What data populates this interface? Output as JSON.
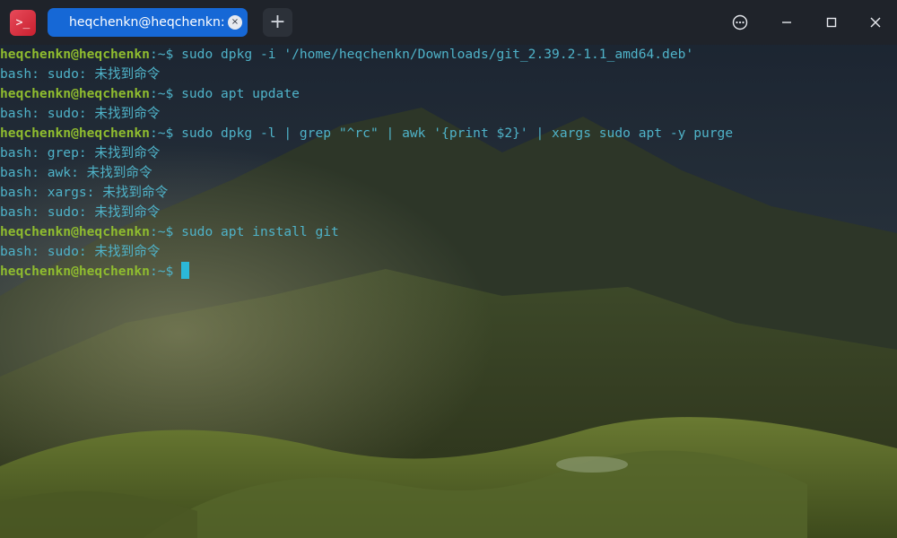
{
  "window": {
    "tab_title": "heqchenkn@heqchenkn: ~",
    "tab_close_glyph": "×",
    "new_tab_glyph": "+",
    "app_icon_glyph": ">_"
  },
  "colors": {
    "titlebar": "#1f232a",
    "active_tab": "#1668d6",
    "prompt_user": "#8fbc2f",
    "text": "#4fb3c9",
    "cursor": "#2bb8d8"
  },
  "terminal": {
    "prompt_user": "heqchenkn@heqchenkn",
    "prompt_path": ":~$ ",
    "lines": [
      {
        "type": "cmd",
        "text": "sudo dpkg -i '/home/heqchenkn/Downloads/git_2.39.2-1.1_amd64.deb'"
      },
      {
        "type": "out",
        "text": "bash: sudo: 未找到命令"
      },
      {
        "type": "cmd",
        "text": "sudo apt update"
      },
      {
        "type": "out",
        "text": "bash: sudo: 未找到命令"
      },
      {
        "type": "cmd",
        "text": "sudo dpkg -l | grep \"^rc\" | awk '{print $2}' | xargs sudo apt -y purge"
      },
      {
        "type": "out",
        "text": "bash: grep: 未找到命令"
      },
      {
        "type": "out",
        "text": "bash: awk: 未找到命令"
      },
      {
        "type": "out",
        "text": "bash: xargs: 未找到命令"
      },
      {
        "type": "out",
        "text": "bash: sudo: 未找到命令"
      },
      {
        "type": "cmd",
        "text": "sudo apt install git"
      },
      {
        "type": "out",
        "text": "bash: sudo: 未找到命令"
      },
      {
        "type": "cmd",
        "text": ""
      }
    ]
  }
}
